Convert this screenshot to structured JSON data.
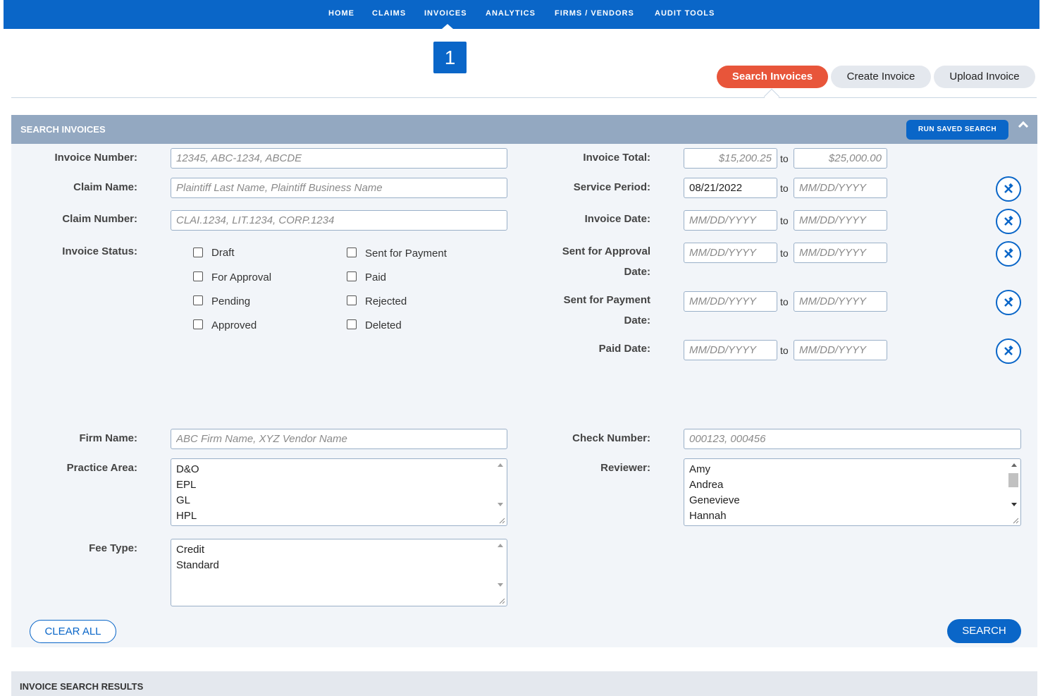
{
  "nav": {
    "items": [
      "HOME",
      "CLAIMS",
      "INVOICES",
      "ANALYTICS",
      "FIRMS / VENDORS",
      "AUDIT TOOLS"
    ],
    "active": "INVOICES"
  },
  "step_badge": "1",
  "tabs": [
    "Search Invoices",
    "Create Invoice",
    "Upload Invoice"
  ],
  "panel": {
    "title": "SEARCH INVOICES",
    "run_saved_search": "RUN SAVED SEARCH"
  },
  "fields": {
    "invoice_number": {
      "label": "Invoice Number:",
      "placeholder": "12345, ABC-1234, ABCDE"
    },
    "claim_name": {
      "label": "Claim Name:",
      "placeholder": "Plaintiff Last Name, Plaintiff Business Name"
    },
    "claim_number": {
      "label": "Claim Number:",
      "placeholder": "CLAI.1234, LIT.1234, CORP.1234"
    },
    "invoice_status": {
      "label": "Invoice Status:",
      "options": [
        "Draft",
        "For Approval",
        "Pending",
        "Approved",
        "Sent for Payment",
        "Paid",
        "Rejected",
        "Deleted"
      ]
    },
    "invoice_total": {
      "label": "Invoice Total:",
      "from": "$15,200.25",
      "to": "$25,000.00"
    },
    "service_period": {
      "label": "Service Period:",
      "from": "08/21/2022",
      "to_placeholder": "MM/DD/YYYY"
    },
    "invoice_date": {
      "label": "Invoice Date:",
      "placeholder": "MM/DD/YYYY"
    },
    "sent_for_approval_date": {
      "label_line1": "Sent for Approval",
      "label_line2": "Date:",
      "placeholder": "MM/DD/YYYY"
    },
    "sent_for_payment_date": {
      "label_line1": "Sent for Payment",
      "label_line2": "Date:",
      "placeholder": "MM/DD/YYYY"
    },
    "paid_date": {
      "label": "Paid Date:",
      "placeholder": "MM/DD/YYYY"
    },
    "to_word": "to",
    "firm_name": {
      "label": "Firm Name:",
      "placeholder": "ABC Firm Name, XYZ Vendor Name"
    },
    "check_number": {
      "label": "Check Number:",
      "placeholder": "000123, 000456"
    },
    "practice_area": {
      "label": "Practice Area:",
      "options": [
        "D&O",
        "EPL",
        "GL",
        "HPL"
      ]
    },
    "reviewer": {
      "label": "Reviewer:",
      "options": [
        "Amy",
        "Andrea",
        "Genevieve",
        "Hannah"
      ]
    },
    "fee_type": {
      "label": "Fee Type:",
      "options": [
        "Credit",
        "Standard"
      ]
    }
  },
  "buttons": {
    "clear_all": "CLEAR ALL",
    "search": "SEARCH"
  },
  "results": {
    "title": "INVOICE SEARCH RESULTS"
  },
  "colors": {
    "brand_blue": "#0a66c8",
    "accent_orange": "#e8553a",
    "panel_header": "#93a8c1",
    "panel_bg": "#f2f5f9"
  }
}
